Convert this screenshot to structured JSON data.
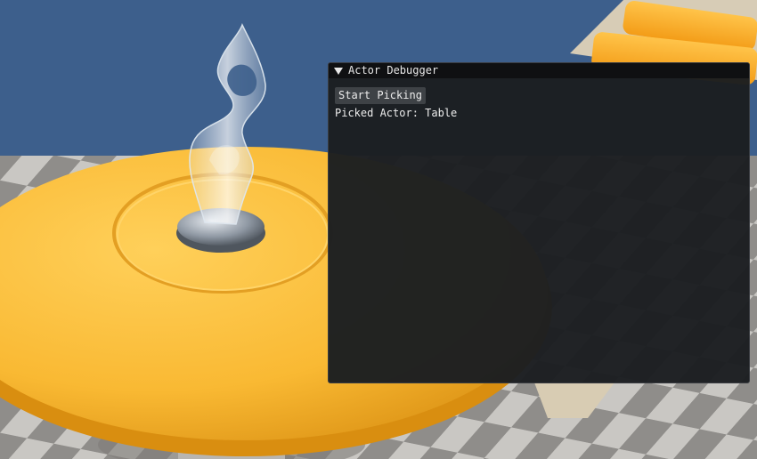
{
  "window": {
    "title": "Actor Debugger",
    "collapse_icon": "triangle-down"
  },
  "controls": {
    "start_picking_label": "Start Picking"
  },
  "status": {
    "picked_label": "Picked Actor:",
    "picked_value": "Table"
  },
  "colors": {
    "sky": "#3d5f8c",
    "table_yellow": "#f9b933",
    "window_bg": "#1b1e21",
    "titlebar_bg": "#0f1012",
    "button_bg": "#3e4246"
  }
}
